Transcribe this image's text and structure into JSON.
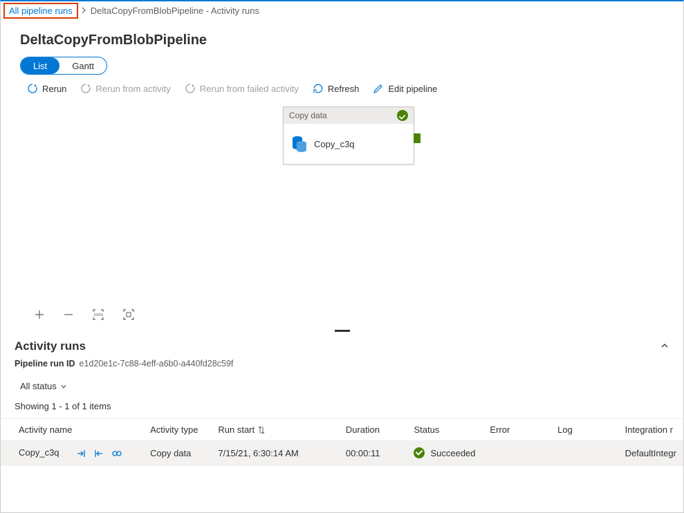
{
  "breadcrumb": {
    "link": "All pipeline runs",
    "current": "DeltaCopyFromBlobPipeline - Activity runs"
  },
  "page_title": "DeltaCopyFromBlobPipeline",
  "view_toggle": {
    "list": "List",
    "gantt": "Gantt"
  },
  "actions": {
    "rerun": "Rerun",
    "rerun_from_activity": "Rerun from activity",
    "rerun_from_failed": "Rerun from failed activity",
    "refresh": "Refresh",
    "edit_pipeline": "Edit pipeline"
  },
  "activity_card": {
    "type_label": "Copy data",
    "name": "Copy_c3q"
  },
  "zoom": {
    "hundred": "100%"
  },
  "activity_runs": {
    "title": "Activity runs",
    "run_id_label": "Pipeline run ID",
    "run_id": "e1d20e1c-7c88-4eff-a6b0-a440fd28c59f",
    "filter": "All status",
    "showing": "Showing 1 - 1 of 1 items"
  },
  "columns": {
    "activity_name": "Activity name",
    "activity_type": "Activity type",
    "run_start": "Run start",
    "duration": "Duration",
    "status": "Status",
    "error": "Error",
    "log": "Log",
    "integration_runtime": "Integration r"
  },
  "rows": [
    {
      "name": "Copy_c3q",
      "type": "Copy data",
      "start": "7/15/21, 6:30:14 AM",
      "duration": "00:00:11",
      "status": "Succeeded",
      "error": "",
      "log": "",
      "integration": "DefaultIntegr"
    }
  ]
}
